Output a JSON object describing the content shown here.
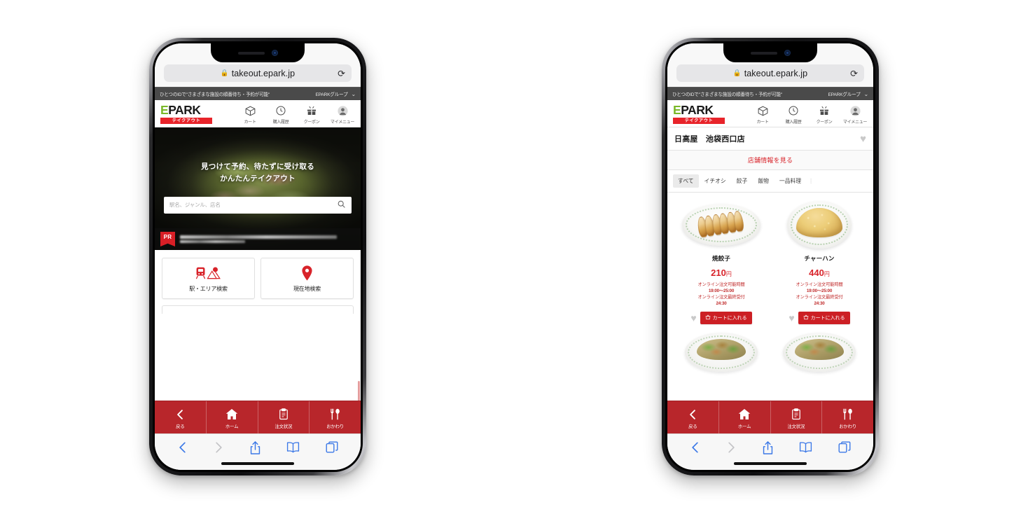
{
  "browser": {
    "url": "takeout.epark.jp",
    "lock_icon": "lock-icon",
    "reload_icon": "reload-icon",
    "toolbar": {
      "back": "back-icon",
      "forward": "forward-icon",
      "share": "share-icon",
      "bookmarks": "bookmarks-icon",
      "tabs": "tabs-icon"
    }
  },
  "promo_bar": {
    "text": "ひとつのIDで\"さまざまな施設の順番待ち・予約が可能\"",
    "group_label": "EPARKグループ",
    "chevron": "chevron-down-icon"
  },
  "site_header": {
    "logo_e": "E",
    "logo_park": "PARK",
    "logo_sub": "テイクアウト",
    "icons": [
      {
        "name": "cart-icon",
        "label": "カート"
      },
      {
        "name": "history-icon",
        "label": "購入履歴"
      },
      {
        "name": "coupon-icon",
        "label": "クーポン"
      },
      {
        "name": "mymenu-icon",
        "label": "マイメニュー"
      }
    ]
  },
  "home": {
    "hero": {
      "title_line1": "見つけて予約、待たずに受け取る",
      "title_line2": "かんたんテイクアウト",
      "search_placeholder": "駅名、ジャンル、店名",
      "search_icon": "search-icon"
    },
    "pr": {
      "badge": "PR"
    },
    "search_cards": [
      {
        "icon": "train-map-icon",
        "label": "駅・エリア検索"
      },
      {
        "icon": "location-pin-icon",
        "label": "現在地検索"
      }
    ]
  },
  "store": {
    "name": "日高屋　池袋西口店",
    "favorite_icon": "heart-icon",
    "info_link": "店舗情報を見る",
    "category_tabs": [
      {
        "label": "すべて",
        "active": true
      },
      {
        "label": "イチオシ",
        "active": false
      },
      {
        "label": "餃子",
        "active": false
      },
      {
        "label": "飯物",
        "active": false
      },
      {
        "label": "一品料理",
        "active": false
      }
    ],
    "tabs_overflow": "⋮",
    "products": [
      {
        "name": "焼餃子",
        "price": "210",
        "currency": "円",
        "order_window_label": "オンライン注文可能時間",
        "order_window": "19:00〜25:00",
        "last_order_label": "オンライン注文最終受付",
        "last_order": "24:30",
        "favorite_icon": "heart-icon",
        "cart_button": "カートに入れる",
        "cart_icon": "basket-icon"
      },
      {
        "name": "チャーハン",
        "price": "440",
        "currency": "円",
        "order_window_label": "オンライン注文可能時間",
        "order_window": "19:00〜25:00",
        "last_order_label": "オンライン注文最終受付",
        "last_order": "24:30",
        "favorite_icon": "heart-icon",
        "cart_button": "カートに入れる",
        "cart_icon": "basket-icon"
      }
    ]
  },
  "app_nav": [
    {
      "icon": "chevron-left-icon",
      "label": "戻る"
    },
    {
      "icon": "home-icon",
      "label": "ホーム"
    },
    {
      "icon": "clipboard-icon",
      "label": "注文状況"
    },
    {
      "icon": "fork-spoon-icon",
      "label": "おかわり"
    }
  ],
  "colors": {
    "brand_red": "#d8232a",
    "nav_red": "#b8262b",
    "cart_red": "#cc1f24",
    "logo_green": "#7ab828"
  }
}
